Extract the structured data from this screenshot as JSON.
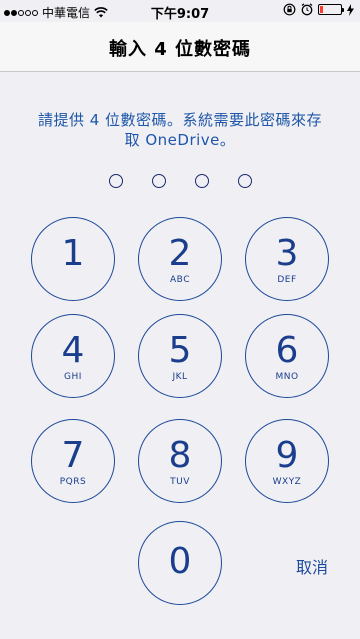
{
  "status_bar": {
    "carrier": "中華電信",
    "time": "下午9:07"
  },
  "nav": {
    "title": "輸入 4 位數密碼"
  },
  "prompt": {
    "line1": "請提供 4 位數密碼。系統需要此密碼來存",
    "line2": "取 OneDrive。"
  },
  "pin": {
    "length": 4,
    "entered": 0
  },
  "keypad": {
    "keys": [
      {
        "digit": "1",
        "letters": ""
      },
      {
        "digit": "2",
        "letters": "ABC"
      },
      {
        "digit": "3",
        "letters": "DEF"
      },
      {
        "digit": "4",
        "letters": "GHI"
      },
      {
        "digit": "5",
        "letters": "JKL"
      },
      {
        "digit": "6",
        "letters": "MNO"
      },
      {
        "digit": "7",
        "letters": "PQRS"
      },
      {
        "digit": "8",
        "letters": "TUV"
      },
      {
        "digit": "9",
        "letters": "WXYZ"
      },
      {
        "digit": "0",
        "letters": ""
      }
    ],
    "cancel_label": "取消"
  },
  "colors": {
    "accent": "#1e4a9a",
    "prompt_text": "#1e56a8",
    "background": "#efeff4",
    "battery_low": "#ff3b30"
  },
  "icons": {
    "signal": "signal-dots-icon",
    "wifi": "wifi-icon",
    "lock_rotation": "rotation-lock-icon",
    "alarm": "alarm-icon",
    "battery": "battery-low-icon",
    "charging": "charging-bolt-icon"
  }
}
